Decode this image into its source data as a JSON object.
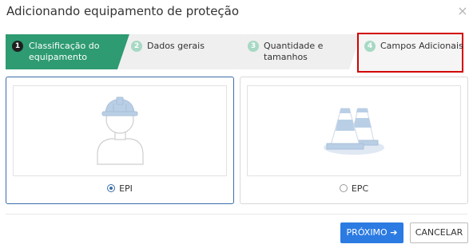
{
  "dialog": {
    "title": "Adicionando equipamento de proteção",
    "close_label": "×"
  },
  "steps": [
    {
      "number": "1",
      "label": "Classificação do equipamento",
      "state": "active"
    },
    {
      "number": "2",
      "label": "Dados gerais",
      "state": "pending"
    },
    {
      "number": "3",
      "label": "Quantidade e tamanhos",
      "state": "pending"
    },
    {
      "number": "4",
      "label": "Campos Adicionais",
      "state": "pending",
      "highlighted": true
    }
  ],
  "options": [
    {
      "label": "EPI",
      "selected": true,
      "icon": "worker-helmet-icon"
    },
    {
      "label": "EPC",
      "selected": false,
      "icon": "traffic-cones-icon"
    }
  ],
  "footer": {
    "next_label": "PRÓXIMO",
    "next_arrow": "➔",
    "cancel_label": "CANCELAR"
  },
  "colors": {
    "active_step": "#2e9b72",
    "pending_step": "#efefef",
    "step_number_pending": "#a7d9c5",
    "selected_border": "#3a6ea8",
    "primary_button": "#2b7be2",
    "highlight_box": "#d30000",
    "illustration_fill": "#b9cfe6"
  }
}
